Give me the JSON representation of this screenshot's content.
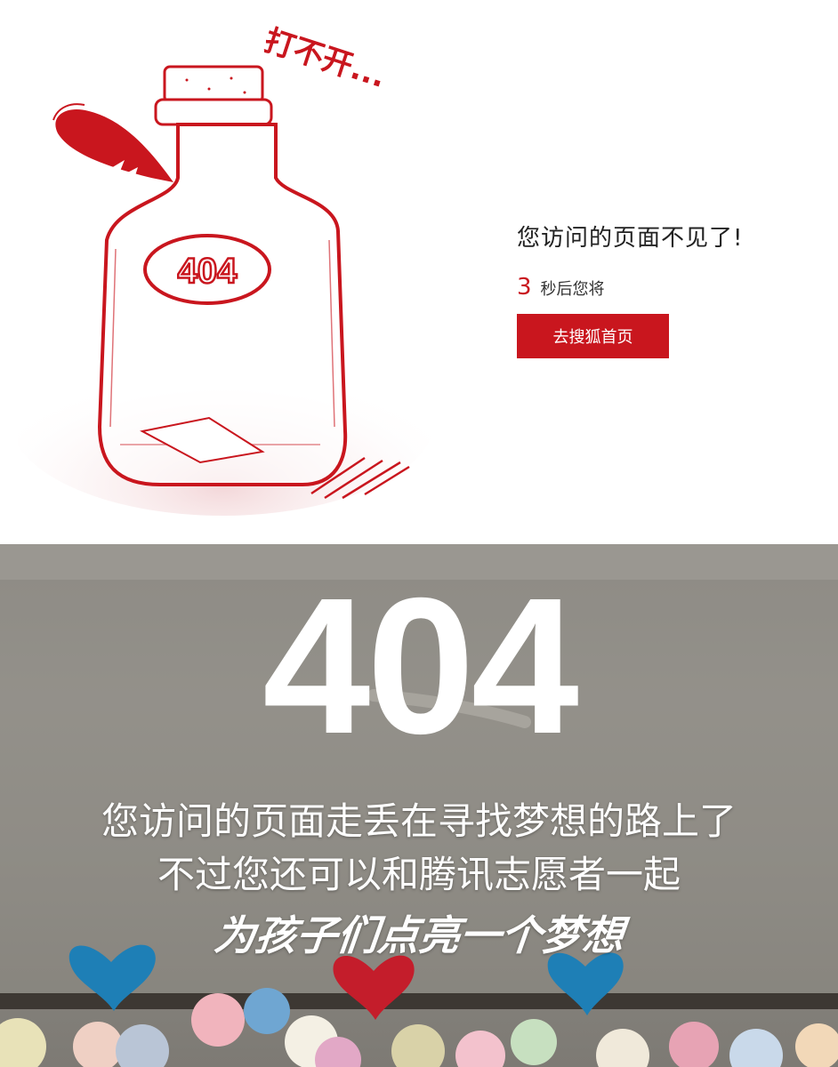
{
  "sohu_404": {
    "bottle_caption": "打不开...",
    "bottle_label": "404",
    "title": "您访问的页面不见了!",
    "countdown_number": "3",
    "countdown_text": "秒后您将",
    "home_button_label": "去搜狐首页",
    "accent_color": "#c9161e"
  },
  "tencent_404": {
    "heading": "404",
    "line1": "您访问的页面走丢在寻找梦想的路上了",
    "line2": "不过您还可以和腾讯志愿者一起",
    "line3": "为孩子们点亮一个梦想"
  }
}
